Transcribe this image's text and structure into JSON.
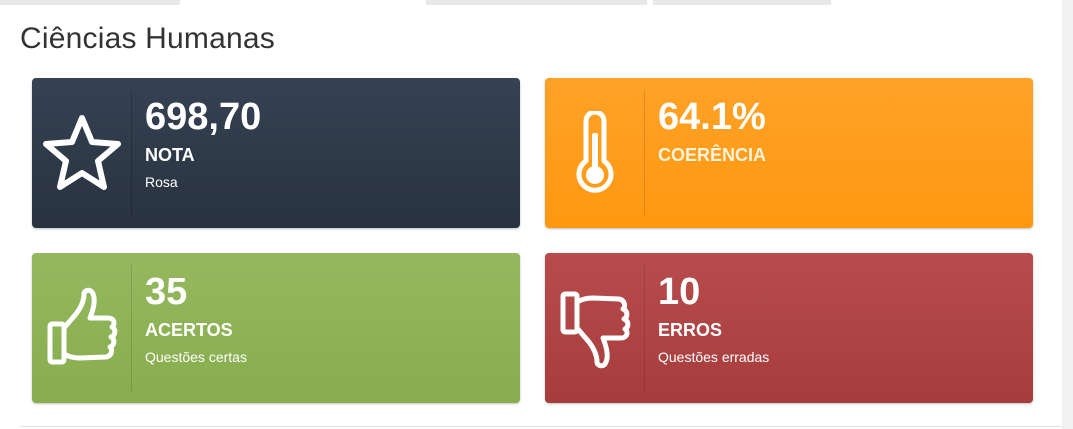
{
  "section": {
    "title": "Ciências Humanas"
  },
  "cards": [
    {
      "value": "698,70",
      "label": "NOTA",
      "sub": "Rosa",
      "icon": "star-icon",
      "color": "#2f3a48"
    },
    {
      "value": "64.1%",
      "label": "COERÊNCIA",
      "sub": "",
      "icon": "thermometer-icon",
      "color": "#ff9e1b"
    },
    {
      "value": "35",
      "label": "ACERTOS",
      "sub": "Questões certas",
      "icon": "thumbs-up-icon",
      "color": "#8eb356"
    },
    {
      "value": "10",
      "label": "ERROS",
      "sub": "Questões erradas",
      "icon": "thumbs-down-icon",
      "color": "#b04545"
    }
  ]
}
